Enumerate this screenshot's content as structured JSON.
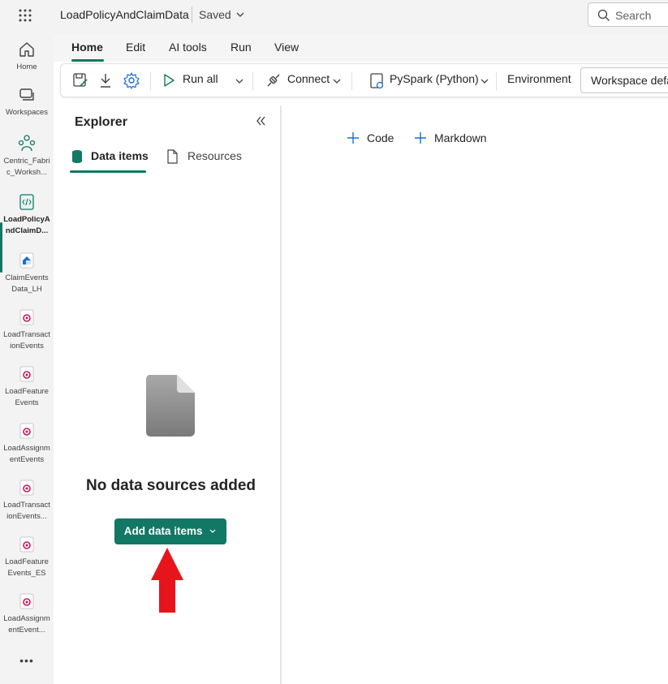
{
  "topbar": {
    "title": "LoadPolicyAndClaimData",
    "saved": "Saved",
    "search_placeholder": "Search"
  },
  "nav": {
    "items": [
      {
        "label": "Home",
        "icon": "home-icon"
      },
      {
        "label": "Workspaces",
        "icon": "workspaces-icon"
      },
      {
        "label": "Centric_Fabric_Worksh...",
        "icon": "workspace-group-icon"
      },
      {
        "label": "LoadPolicyAndClaimD...",
        "icon": "notebook-icon",
        "active": true
      },
      {
        "label": "ClaimEventsData_LH",
        "icon": "lakehouse-icon"
      },
      {
        "label": "LoadTransactionEvents",
        "icon": "eventstream-icon"
      },
      {
        "label": "LoadFeatureEvents",
        "icon": "eventstream-icon"
      },
      {
        "label": "LoadAssignmentEvents",
        "icon": "eventstream-icon"
      },
      {
        "label": "LoadTransactionEvents...",
        "icon": "eventstream-icon"
      },
      {
        "label": "LoadFeatureEvents_ES",
        "icon": "eventstream-icon"
      },
      {
        "label": "LoadAssignmentEvent...",
        "icon": "eventstream-icon"
      }
    ],
    "more": "•••"
  },
  "tabs": [
    "Home",
    "Edit",
    "AI tools",
    "Run",
    "View"
  ],
  "ribbon": {
    "run_all": "Run all",
    "connect": "Connect",
    "language": "PySpark (Python)",
    "environment": "Environment",
    "workspace_default": "Workspace default"
  },
  "explorer": {
    "title": "Explorer",
    "tab_data_items": "Data items",
    "tab_resources": "Resources",
    "empty_message": "No data sources added",
    "add_button": "Add data items"
  },
  "canvas": {
    "add_code": "Code",
    "add_markdown": "Markdown"
  },
  "colors": {
    "accent": "#117865",
    "annotation_arrow": "#e8141c"
  }
}
